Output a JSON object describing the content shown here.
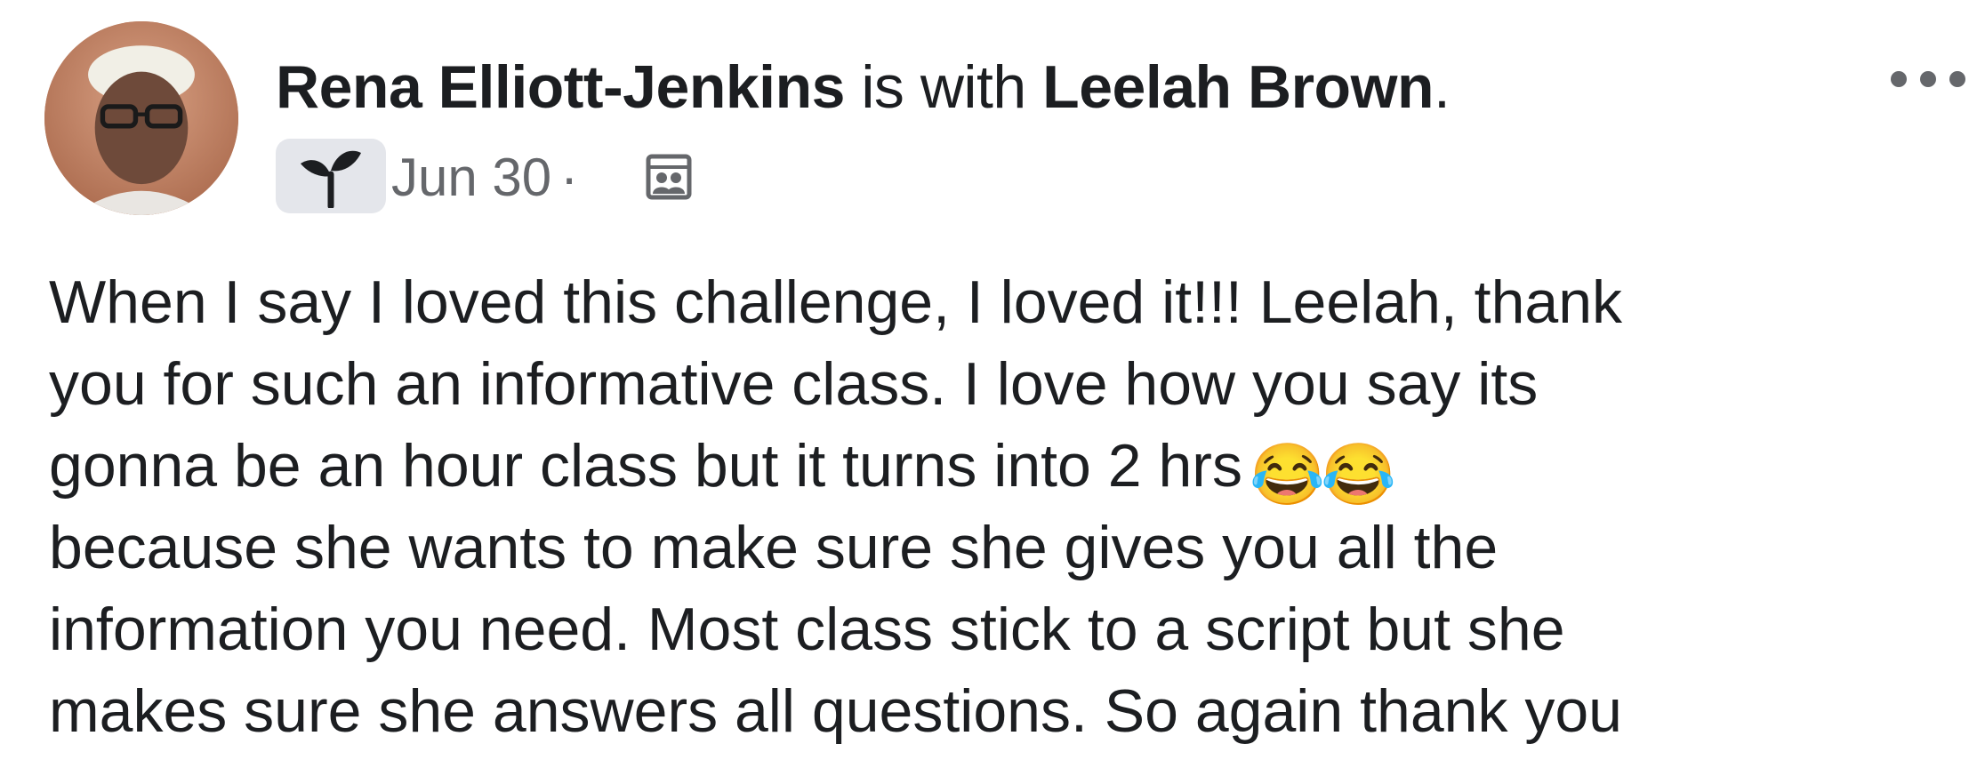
{
  "post": {
    "author": "Rena Elliott-Jenkins",
    "connector": "is with",
    "tagged": "Leelah Brown",
    "period": ".",
    "date": "Jun 30",
    "separator": "·",
    "badge_icon": "sprout-icon",
    "audience_icon": "group-icon",
    "more_icon": "more-options-icon",
    "body_lines": [
      "When I say I loved this challenge, I loved it!!! Leelah, thank",
      "you for such an informative class. I love how you say its",
      "gonna be an hour class but it turns into 2 hrs",
      "because she wants to make sure she gives you all the",
      "information you need. Most class stick to a script but she",
      "makes sure she answers all questions. So again thank you"
    ],
    "emoji": [
      "😂",
      "😂"
    ]
  },
  "colors": {
    "text": "#1c1e21",
    "secondary": "#65676b",
    "badge_bg": "#e4e6eb"
  }
}
